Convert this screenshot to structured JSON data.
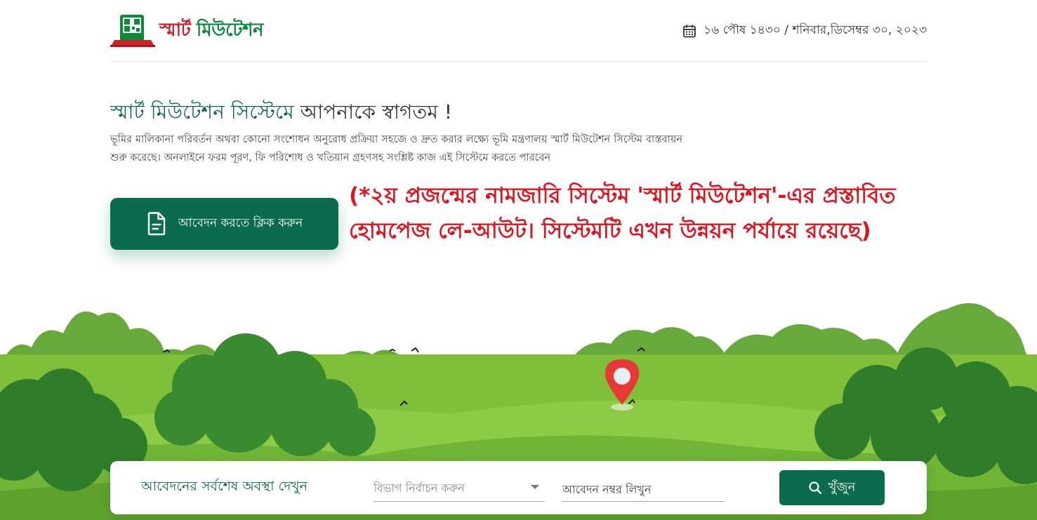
{
  "header": {
    "logo_text_part1": "স্মার্ট",
    "logo_text_part2": " মিউটেশন",
    "date_text": "১৬ পৌষ ১৪৩০ / শনিবার,ডিসেম্বর ৩০, ২০২৩"
  },
  "welcome": {
    "title_part1": "স্মার্ট মিউটেশন সিস্টেমে",
    "title_part2": " আপনাকে স্বাগতম !",
    "description": "ভূমির মালিকানা পরিবর্তন অথবা কোনো সংশোধন অনুরোধ প্রক্রিয়া সহজে ও দ্রুত করার লক্ষ্যে ভূমি মন্ত্রণালয় স্মার্ট মিউটেশন সিস্টেম বাস্তবায়ন শুরু করেছে। অনলাইনে ফরম পূরণ, ফি পরিশোধ ও খতিয়ান গ্রহণসহ সংশ্লিষ্ট কাজ এই সিস্টেমে করতে পারবেন",
    "apply_button_label": "আবেদন করতে ক্লিক করুন"
  },
  "notice": {
    "line1": "(*২য় প্রজন্মের নামজারি সিস্টেম 'স্মার্ট মিউটেশন'-এর প্রস্তাবিত",
    "line2": "হোমপেজ লে-আউট। সিস্টেমটি এখন উন্নয়ন পর্যায়ে রয়েছে)"
  },
  "search": {
    "label": "আবেদনের সর্বশেষ অবস্থা দেখুন",
    "division_select_placeholder": "বিভাগ নির্বাচন করুন",
    "application_number_placeholder": "আবেদন নম্বর লিখুন",
    "search_button_label": "খুঁজুন"
  },
  "colors": {
    "primary_green": "#0b6b4d",
    "logo_red": "#d0202a",
    "logo_green": "#0c8a3c",
    "notice_red": "#e0141e",
    "grass_green": "#7fbf3a",
    "tree_dark": "#2f7d2a"
  },
  "icons": {
    "calendar": "calendar-icon",
    "document": "document-icon",
    "search": "search-icon",
    "location_pin": "location-pin-icon"
  }
}
